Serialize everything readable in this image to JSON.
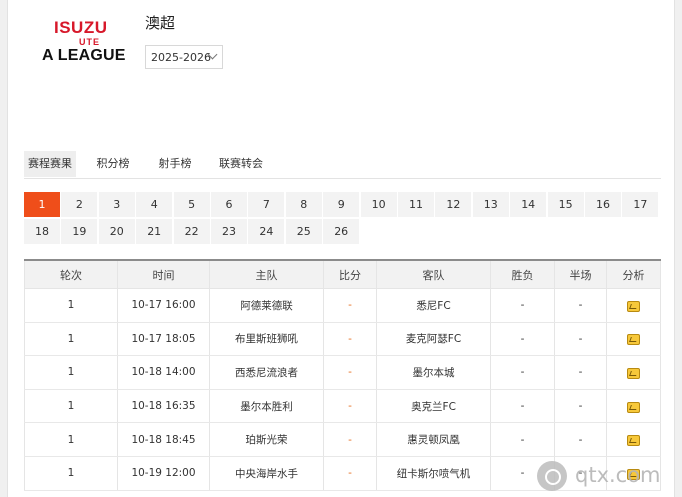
{
  "header": {
    "logo": {
      "line1": "ISUZU",
      "line2": "UTE",
      "line3": "A LEAGUE"
    },
    "league_title": "澳超",
    "season_select": "2025-2026"
  },
  "tabs": [
    {
      "label": "赛程赛果",
      "active": true
    },
    {
      "label": "积分榜",
      "active": false
    },
    {
      "label": "射手榜",
      "active": false
    },
    {
      "label": "联赛转会",
      "active": false
    }
  ],
  "rounds": [
    "1",
    "2",
    "3",
    "4",
    "5",
    "6",
    "7",
    "8",
    "9",
    "10",
    "11",
    "12",
    "13",
    "14",
    "15",
    "16",
    "17",
    "18",
    "19",
    "20",
    "21",
    "22",
    "23",
    "24",
    "25",
    "26"
  ],
  "active_round": "1",
  "colors": {
    "accent": "#ef4e1a",
    "score": "#e56d1e",
    "logo_red": "#d7182a"
  },
  "table": {
    "headers": [
      "轮次",
      "时间",
      "主队",
      "比分",
      "客队",
      "胜负",
      "半场",
      "分析"
    ],
    "rows": [
      {
        "round": "1",
        "time": "10-17 16:00",
        "home": "阿德莱德联",
        "score": "-",
        "away": "悉尼FC",
        "result": "-",
        "half": "-",
        "analysis_icon": "analysis-chart-icon"
      },
      {
        "round": "1",
        "time": "10-17 18:05",
        "home": "布里斯班狮吼",
        "score": "-",
        "away": "麦克阿瑟FC",
        "result": "-",
        "half": "-",
        "analysis_icon": "analysis-chart-icon"
      },
      {
        "round": "1",
        "time": "10-18 14:00",
        "home": "西悉尼流浪者",
        "score": "-",
        "away": "墨尔本城",
        "result": "-",
        "half": "-",
        "analysis_icon": "analysis-chart-icon"
      },
      {
        "round": "1",
        "time": "10-18 16:35",
        "home": "墨尔本胜利",
        "score": "-",
        "away": "奥克兰FC",
        "result": "-",
        "half": "-",
        "analysis_icon": "analysis-chart-icon"
      },
      {
        "round": "1",
        "time": "10-18 18:45",
        "home": "珀斯光荣",
        "score": "-",
        "away": "惠灵顿凤凰",
        "result": "-",
        "half": "-",
        "analysis_icon": "analysis-chart-icon"
      },
      {
        "round": "1",
        "time": "10-19 12:00",
        "home": "中央海岸水手",
        "score": "-",
        "away": "纽卡斯尔喷气机",
        "result": "-",
        "half": "-",
        "analysis_icon": "analysis-chart-icon"
      }
    ]
  },
  "watermark": {
    "text": "qtx.com"
  }
}
